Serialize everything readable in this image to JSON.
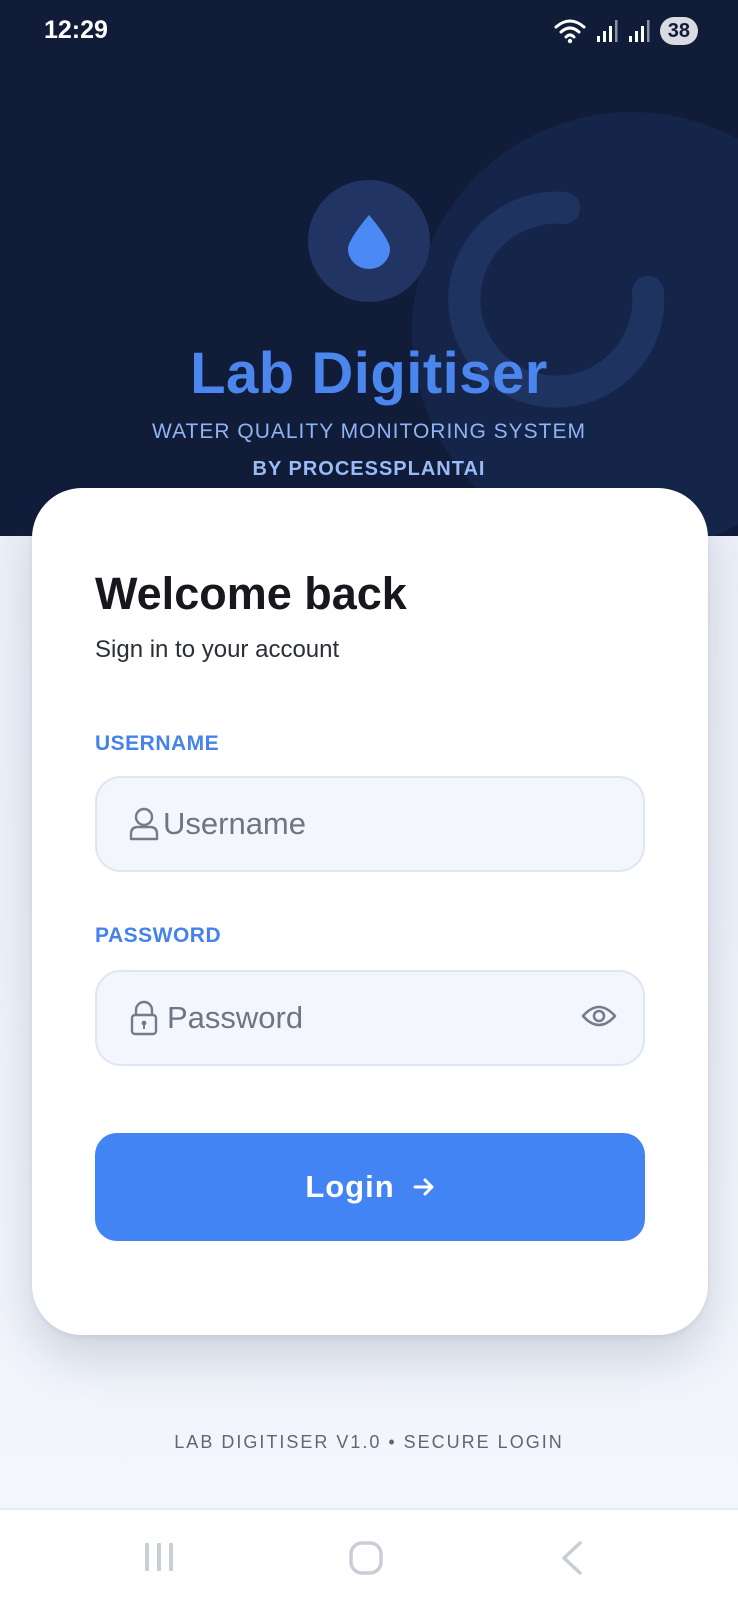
{
  "status": {
    "time": "12:29",
    "battery": "38"
  },
  "app": {
    "title": "Lab Digitiser",
    "subtitle": "WATER QUALITY MONITORING SYSTEM",
    "by_line": "BY PROCESSPLANTAI"
  },
  "login": {
    "heading": "Welcome back",
    "subheading": "Sign in to your account",
    "username_label": "USERNAME",
    "username_placeholder": "Username",
    "username_value": "",
    "password_label": "PASSWORD",
    "password_placeholder": "Password",
    "password_value": "",
    "button_label": "Login"
  },
  "footer": {
    "text": "LAB DIGITISER V1.0 • SECURE LOGIN"
  },
  "icons": {
    "logo": "water-drop-icon",
    "username": "user-icon",
    "password": "lock-icon",
    "show_password": "eye-icon",
    "login": "arrow-right-icon"
  },
  "colors": {
    "header_bg": "#111c39",
    "accent": "#4384f5",
    "title": "#4b86ee",
    "label": "#4582ec"
  }
}
